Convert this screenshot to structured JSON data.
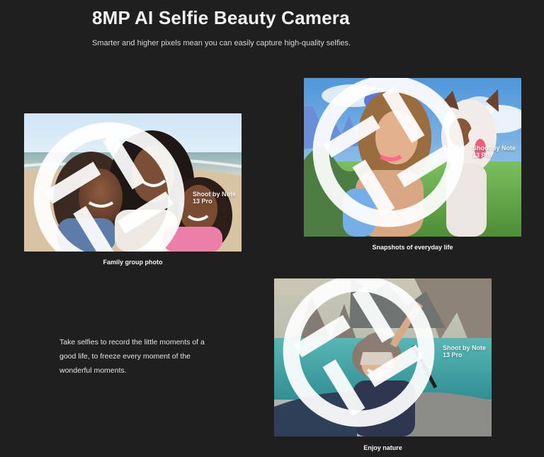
{
  "page": {
    "title": "8MP AI Selfie Beauty Camera",
    "subtitle": "Smarter and higher pixels mean you can easily capture high-quality selfies."
  },
  "photos": {
    "family": {
      "watermark": "Shoot by Note 13 Pro",
      "caption": "Family group photo"
    },
    "dog": {
      "watermark": "Shoot by Note 13 Pro",
      "caption": "Snapshots of everyday life"
    },
    "nature": {
      "watermark": "Shoot by Note 13 Pro",
      "caption": "Enjoy nature"
    }
  },
  "content": {
    "body_text": "Take selfies to record the little moments of a good life, to freeze every moment of the wonderful moments."
  },
  "colors": {
    "background": "#1f1f1f",
    "text": "#ffffff",
    "muted_text": "#d7d7d7"
  },
  "icons": {
    "watermark": "camera-aperture-icon"
  }
}
